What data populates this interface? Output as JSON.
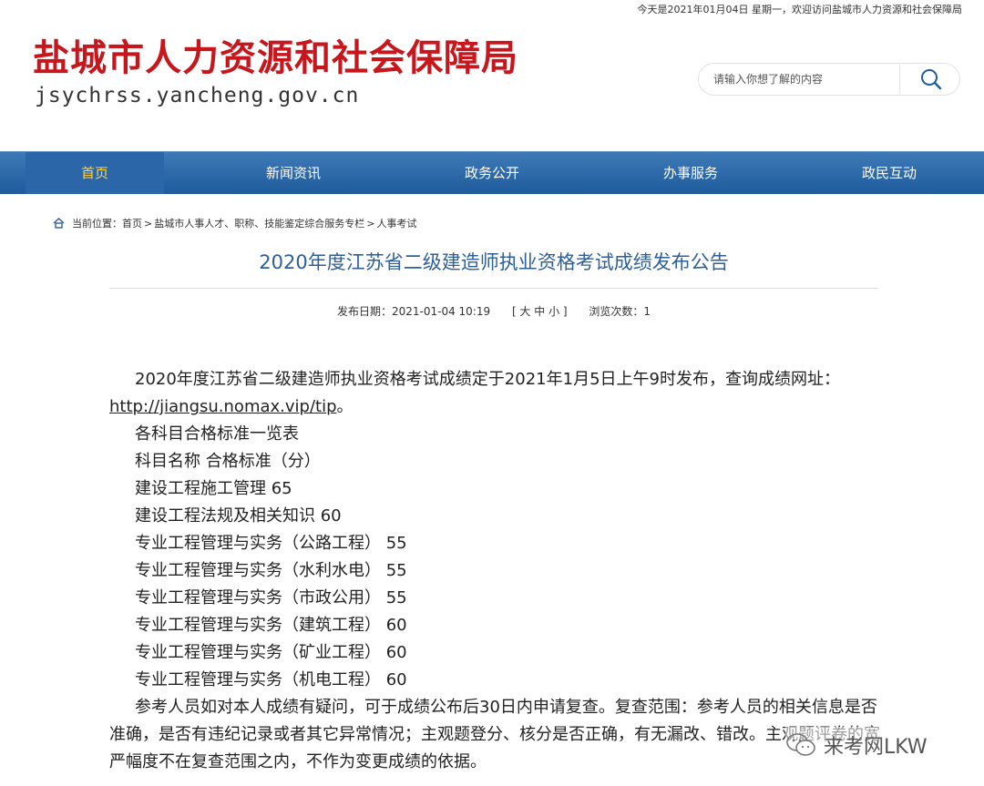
{
  "topbar": {
    "text": "今天是2021年01月04日 星期一，欢迎访问盐城市人力资源和社会保障局"
  },
  "header": {
    "title": "盐城市人力资源和社会保障局",
    "domain": "jsychrss.yancheng.gov.cn",
    "brand_color": "#c8161d"
  },
  "search": {
    "placeholder": "请输入你想了解的内容",
    "icon": "search-icon"
  },
  "nav": {
    "items": [
      {
        "label": "首页"
      },
      {
        "label": "新闻资讯"
      },
      {
        "label": "政务公开"
      },
      {
        "label": "办事服务"
      },
      {
        "label": "政民互动"
      }
    ],
    "active_color": "#ffd648",
    "bg_color": "#2a66a8"
  },
  "breadcrumb": {
    "prefix": "当前位置：",
    "home": "首页",
    "sep1": ">",
    "section": "盐城市人事人才、职称、技能鉴定综合服务专栏",
    "sep2": ">",
    "current": "人事考试"
  },
  "article": {
    "title": "2020年度江苏省二级建造师执业资格考试成绩发布公告",
    "date_label": "发布日期：2021-01-04 10:19",
    "font_size_control": "[ 大 中 小 ]",
    "views_label": "浏览次数：1",
    "intro": "2020年度江苏省二级建造师执业资格考试成绩定于2021年1月5日上午9时发布，查询成绩网址：",
    "link": "http://jiangsu.nomax.vip/tip",
    "intro_end": "。",
    "lines": [
      "各科目合格标准一览表",
      "科目名称 合格标准（分）",
      "建设工程施工管理 65",
      "建设工程法规及相关知识 60",
      "专业工程管理与实务（公路工程） 55",
      "专业工程管理与实务（水利水电） 55",
      "专业工程管理与实务（市政公用） 55",
      "专业工程管理与实务（建筑工程） 60",
      "专业工程管理与实务（矿业工程） 60",
      "专业工程管理与实务（机电工程） 60"
    ],
    "review": "参考人员如对本人成绩有疑问，可于成绩公布后30日内申请复查。复查范围：参考人员的相关信息是否准确，是否有违纪记录或者其它异常情况；主观题登分、核分是否正确，有无漏改、错改。主观题评卷的宽严幅度不在复查范围之内，不作为变更成绩的依据。",
    "title_color": "#2d5f99"
  },
  "watermark": {
    "text": "来考网LKW",
    "icon": "wechat-icon"
  }
}
